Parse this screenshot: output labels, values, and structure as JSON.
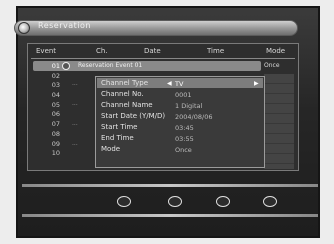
{
  "window_title": "Reservation",
  "columns": [
    "Event",
    "Ch.",
    "Date",
    "Time",
    "Mode"
  ],
  "event_numbers": [
    "01",
    "02",
    "03",
    "04",
    "05",
    "06",
    "07",
    "08",
    "09",
    "10"
  ],
  "selected_row": {
    "index": "01",
    "text": "Reservation Event 01",
    "badge": "Once"
  },
  "edit_popup": {
    "fields": [
      {
        "label": "Channel Type",
        "value": "TV"
      },
      {
        "label": "Channel No.",
        "value": "0001"
      },
      {
        "label": "Channel Name",
        "value": "1 Digital"
      },
      {
        "label": "Start Date (Y/M/D)",
        "value": "2004/08/06"
      },
      {
        "label": "Start Time",
        "value": "03:45"
      },
      {
        "label": "End Time",
        "value": "03:55"
      },
      {
        "label": "Mode",
        "value": "Once"
      }
    ]
  },
  "footer_buttons": [
    {
      "icon": "circle-button-1-icon"
    },
    {
      "icon": "circle-button-2-icon"
    },
    {
      "icon": "circle-button-3-icon"
    },
    {
      "icon": "circle-button-4-icon"
    }
  ]
}
